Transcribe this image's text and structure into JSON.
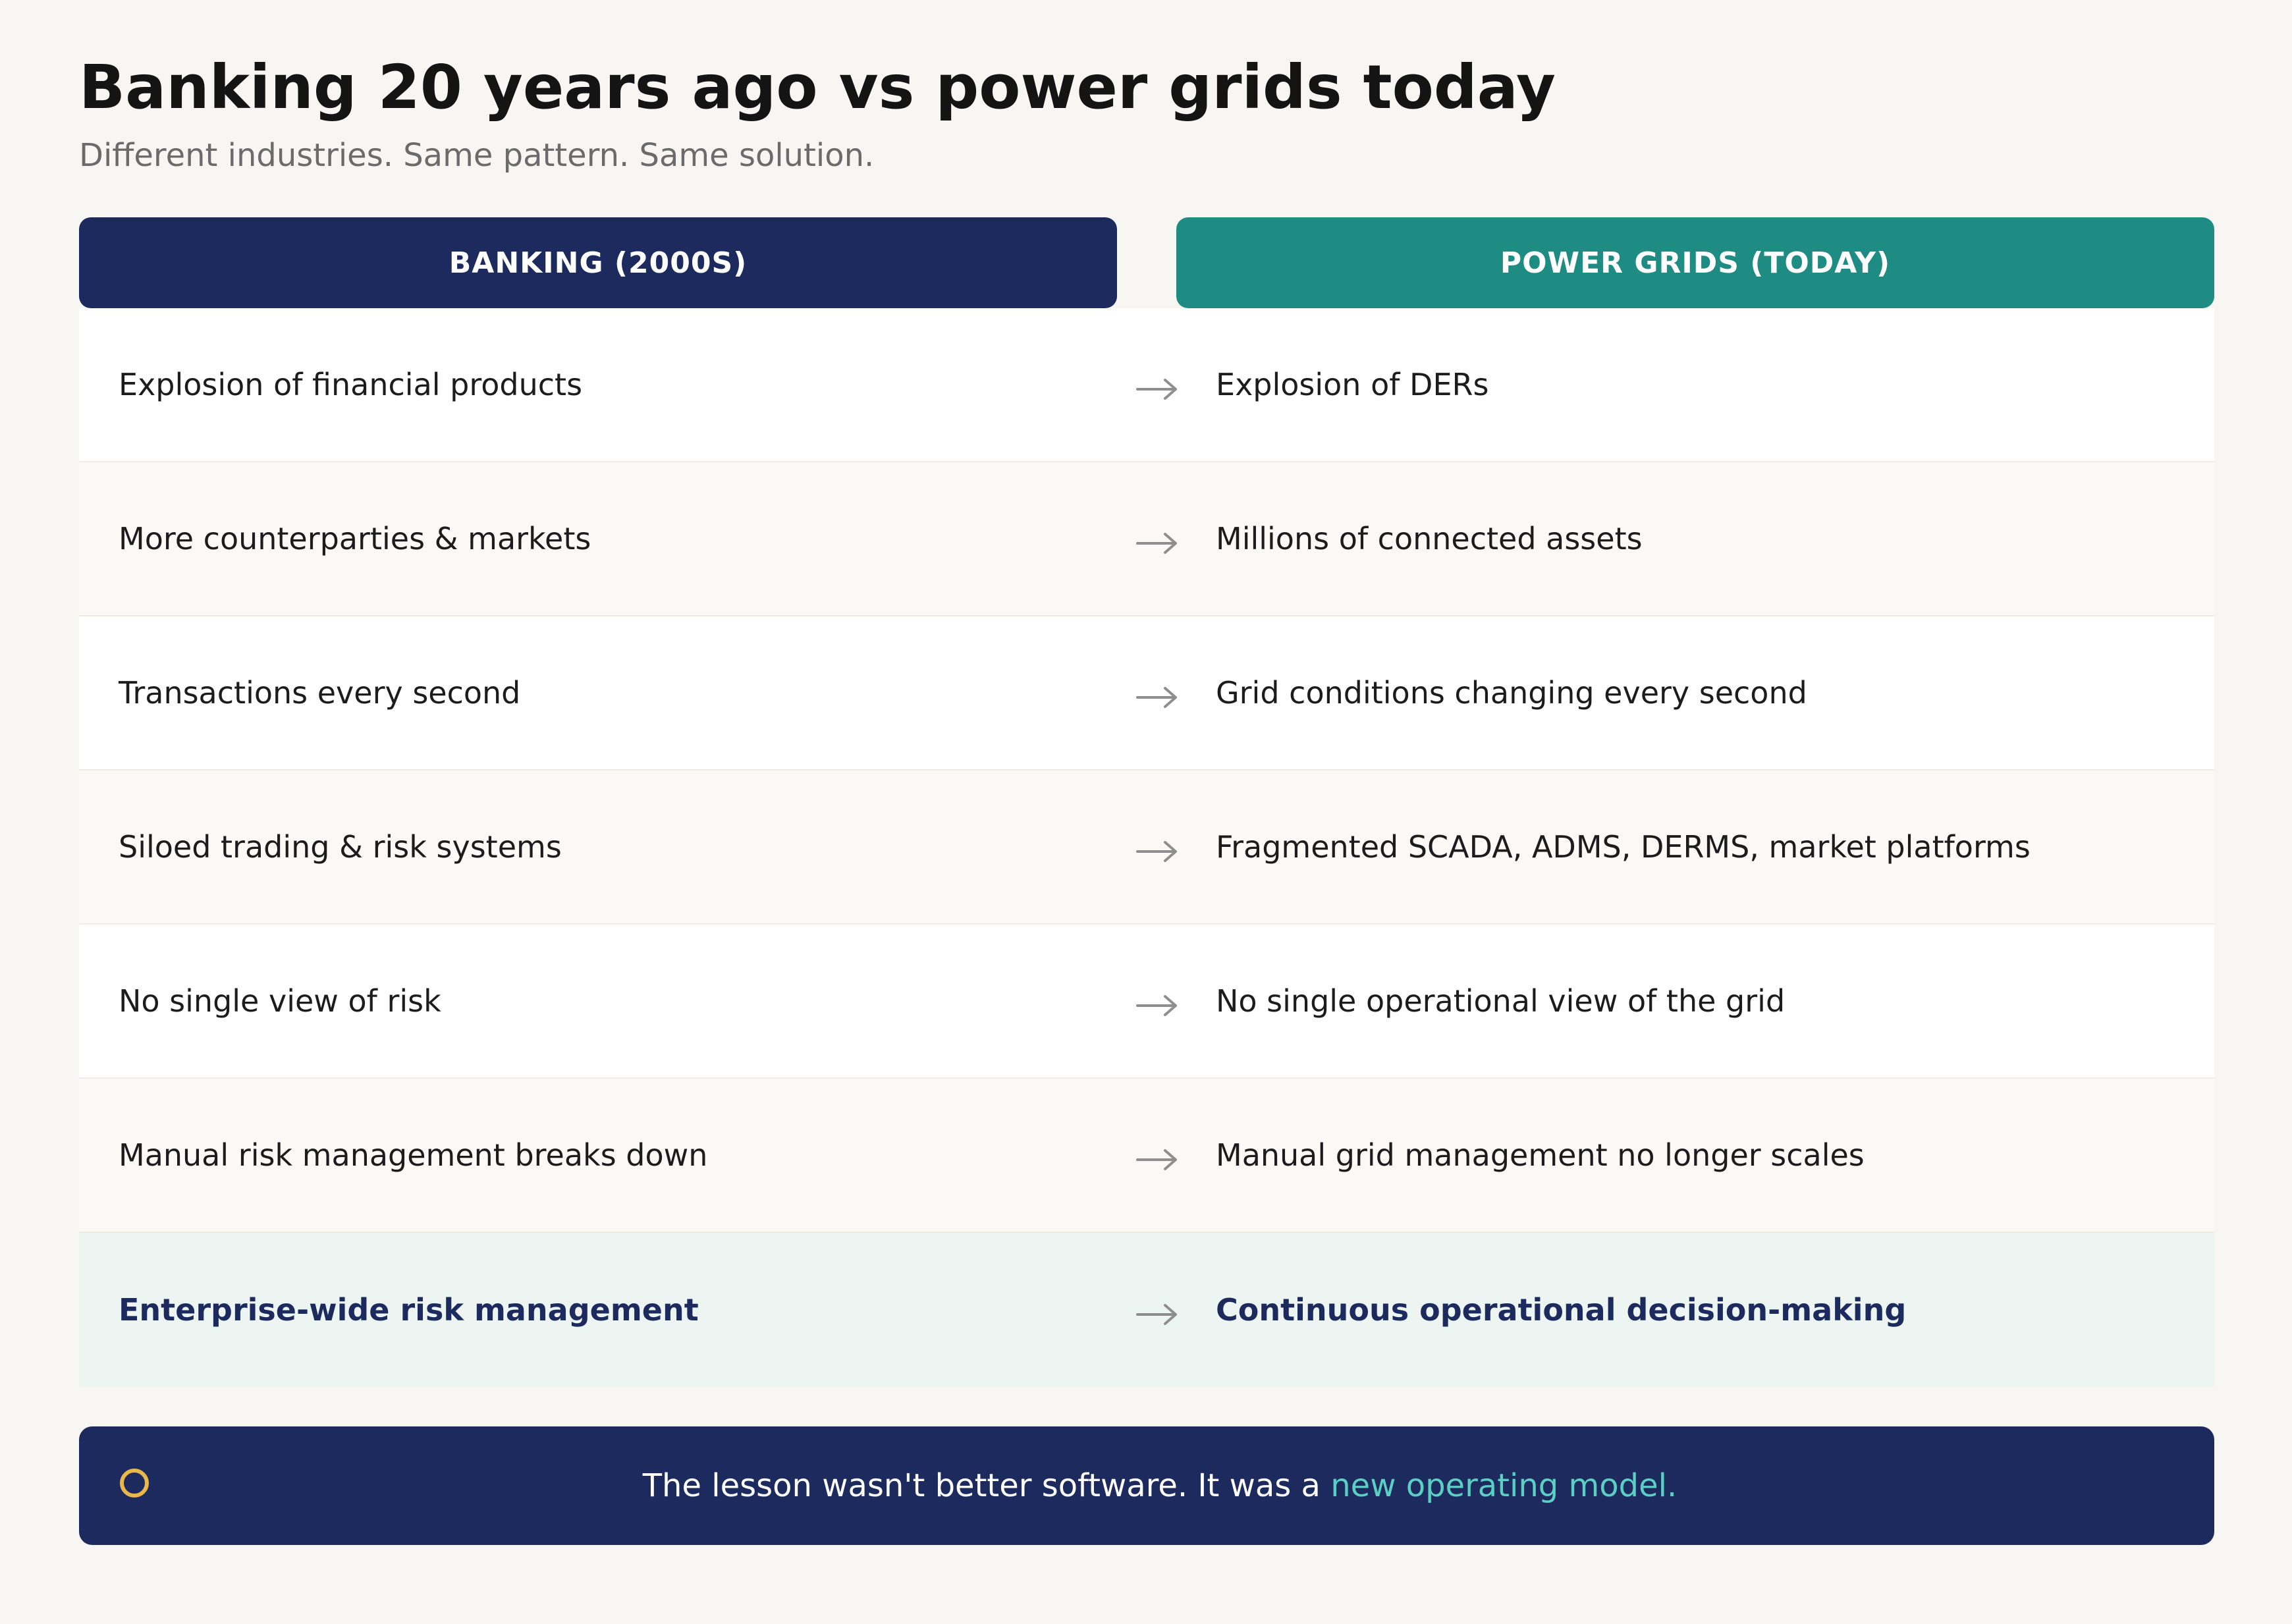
{
  "header": {
    "title": "Banking 20 years ago vs power grids today",
    "subtitle": "Different industries. Same pattern. Same solution."
  },
  "columns": {
    "left": "BANKING (2000S)",
    "right": "POWER GRIDS (TODAY)"
  },
  "rows": [
    {
      "left": "Explosion of financial products",
      "right": "Explosion of DERs"
    },
    {
      "left": "More counterparties & markets",
      "right": "Millions of connected assets"
    },
    {
      "left": "Transactions every second",
      "right": "Grid conditions changing every second"
    },
    {
      "left": "Siloed trading & risk systems",
      "right": "Fragmented SCADA, ADMS, DERMS, market platforms"
    },
    {
      "left": "No single view of risk",
      "right": "No single operational view of the grid"
    },
    {
      "left": "Manual risk management breaks down",
      "right": "Manual grid management no longer scales"
    },
    {
      "left": "Enterprise-wide risk management",
      "right": "Continuous operational decision-making"
    }
  ],
  "banner": {
    "text": "The lesson wasn't better software. It was a ",
    "highlight": "new operating model.",
    "icon": "circle-icon"
  },
  "colors": {
    "navy": "#1c2a5e",
    "teal": "#1e8c82",
    "highlight": "#5ccfc4",
    "icon_ring": "#e8b84a",
    "arrow": "#8e8e8e"
  }
}
